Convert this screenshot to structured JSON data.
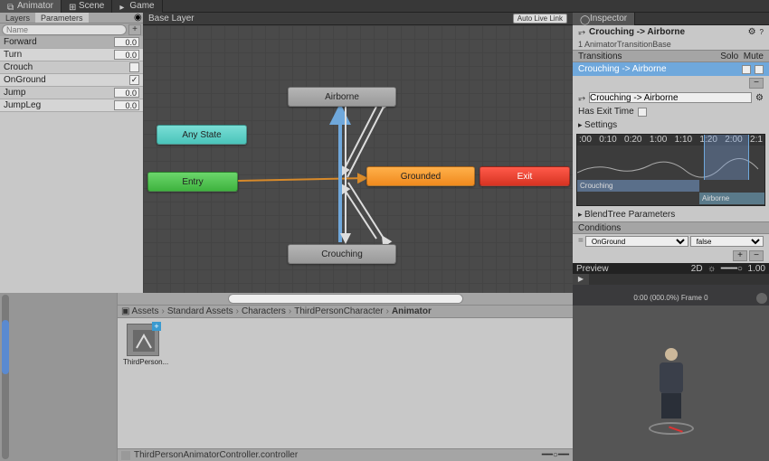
{
  "tabs": {
    "animator": "Animator",
    "scene": "Scene",
    "game": "Game",
    "inspector": "Inspector"
  },
  "left": {
    "subtabs": {
      "layers": "Layers",
      "parameters": "Parameters"
    },
    "search_placeholder": "Name",
    "params": [
      {
        "name": "Forward",
        "value": "0.0",
        "type": "float"
      },
      {
        "name": "Turn",
        "value": "0.0",
        "type": "float"
      },
      {
        "name": "Crouch",
        "type": "bool",
        "checked": false
      },
      {
        "name": "OnGround",
        "type": "bool",
        "checked": true
      },
      {
        "name": "Jump",
        "value": "0.0",
        "type": "float"
      },
      {
        "name": "JumpLeg",
        "value": "0.0",
        "type": "float"
      }
    ]
  },
  "graph": {
    "layer": "Base Layer",
    "auto_live": "Auto Live Link",
    "states": {
      "any": "Any State",
      "entry": "Entry",
      "airborne": "Airborne",
      "grounded": "Grounded",
      "crouching": "Crouching",
      "exit": "Exit"
    },
    "path": "Standard Assets/Characters/ThirdPersonCharacter/Animator/ThirdPersonAnimatorController.controller"
  },
  "inspector": {
    "title": "Crouching -> Airborne",
    "subtitle": "1 AnimatorTransitionBase",
    "transitions_label": "Transitions",
    "solo": "Solo",
    "mute": "Mute",
    "transition_item": "Crouching -> Airborne",
    "name_field": "Crouching -> Airborne",
    "has_exit_label": "Has Exit Time",
    "settings_label": "Settings",
    "timeline_ticks": [
      ":00",
      "0:10",
      "0:20",
      "1:00",
      "1:10",
      "1:20",
      "2:00",
      "2:1"
    ],
    "band_a": "Crouching",
    "band_b": "Airborne",
    "blendtree_label": "BlendTree Parameters",
    "conditions_label": "Conditions",
    "cond_param": "OnGround",
    "cond_value": "false",
    "preview_label": "Preview",
    "preview_2d": "2D",
    "preview_speed": "1.00",
    "preview_status": "0:00 (000.0%) Frame 0"
  },
  "project": {
    "breadcrumb": [
      "Assets",
      "Standard Assets",
      "Characters",
      "ThirdPersonCharacter",
      "Animator"
    ],
    "asset_name": "ThirdPerson...",
    "status": "ThirdPersonAnimatorController.controller"
  }
}
